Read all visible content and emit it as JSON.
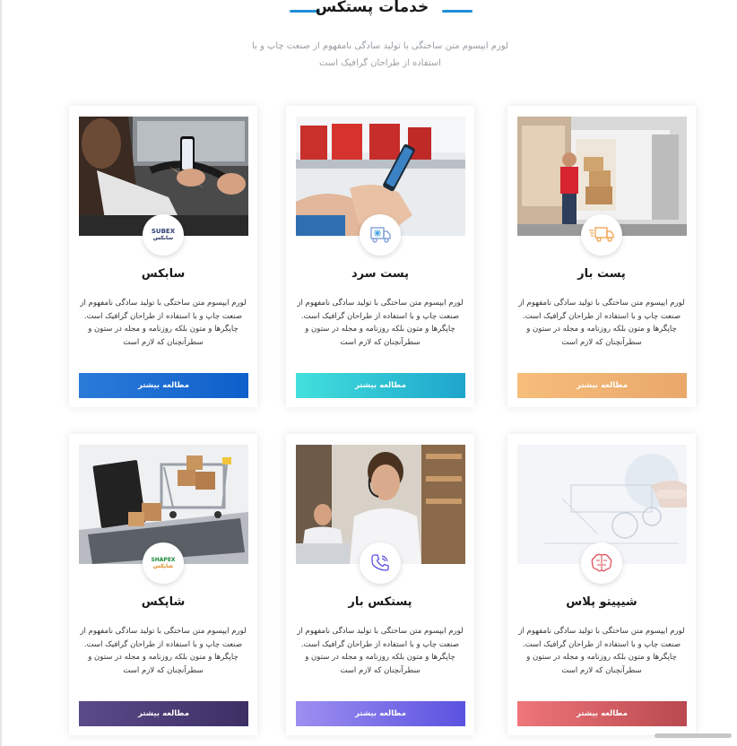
{
  "section": {
    "title": "خدمات پستکس",
    "subtitle": "لورم ایپسوم متن ساختگی با تولید سادگی نامفهوم از صنعت چاپ و با استفاده از طراحان گرافیک است"
  },
  "cards": [
    {
      "title": "پست بار",
      "icon": "delivery-truck-icon",
      "description": "لورم ایپسوم متن ساختگی با تولید سادگی نامفهوم از صنعت چاپ و با استفاده از طراحان گرافیک است. چاپگرها و متون بلکه روزنامه و مجله در ستون و سطرآنچنان که لازم است",
      "button": "مطالعه بیشتر",
      "button_colors": [
        "#f6bd7b",
        "#e9a86a"
      ]
    },
    {
      "title": "پست سرد",
      "icon": "cold-truck-icon",
      "description": "لورم ایپسوم متن ساختگی با تولید سادگی نامفهوم از صنعت چاپ و با استفاده از طراحان گرافیک است. چاپگرها و متون بلکه روزنامه و مجله در ستون و سطرآنچنان که لازم است",
      "button": "مطالعه بیشتر",
      "button_colors": [
        "#42e0dc",
        "#1ea5cd"
      ]
    },
    {
      "title": "سابکس",
      "icon": "subex-logo",
      "logo_text": [
        "SUBEX",
        "سابکس"
      ],
      "description": "لورم ایپسوم متن ساختگی با تولید سادگی نامفهوم از صنعت چاپ و با استفاده از طراحان گرافیک است. چاپگرها و متون بلکه روزنامه و مجله در ستون و سطرآنچنان که لازم است",
      "button": "مطالعه بیشتر",
      "button_colors": [
        "#2a7bd8",
        "#0f5fcb"
      ]
    },
    {
      "title": "شیپیتو پلاس",
      "icon": "brain-icon",
      "description": "لورم ایپسوم متن ساختگی با تولید سادگی نامفهوم از صنعت چاپ و با استفاده از طراحان گرافیک است. چاپگرها و متون بلکه روزنامه و مجله در ستون و سطرآنچنان که لازم است",
      "button": "مطالعه بیشتر",
      "button_colors": [
        "#ef767a",
        "#b8494f"
      ]
    },
    {
      "title": "پستکس بار",
      "icon": "phone-call-icon",
      "description": "لورم ایپسوم متن ساختگی با تولید سادگی نامفهوم از صنعت چاپ و با استفاده از طراحان گرافیک است. چاپگرها و متون بلکه روزنامه و مجله در ستون و سطرآنچنان که لازم است",
      "button": "مطالعه بیشتر",
      "button_colors": [
        "#9d8ff0",
        "#5b52e0"
      ]
    },
    {
      "title": "شاپکس",
      "icon": "shapex-logo",
      "logo_text": [
        "SHAPEX",
        "شاپکس"
      ],
      "description": "لورم ایپسوم متن ساختگی با تولید سادگی نامفهوم از صنعت چاپ و با استفاده از طراحان گرافیک است. چاپگرها و متون بلکه روزنامه و مجله در ستون و سطرآنچنان که لازم است",
      "button": "مطالعه بیشتر",
      "button_colors": [
        "#5b4a8a",
        "#3d2f64"
      ]
    }
  ]
}
